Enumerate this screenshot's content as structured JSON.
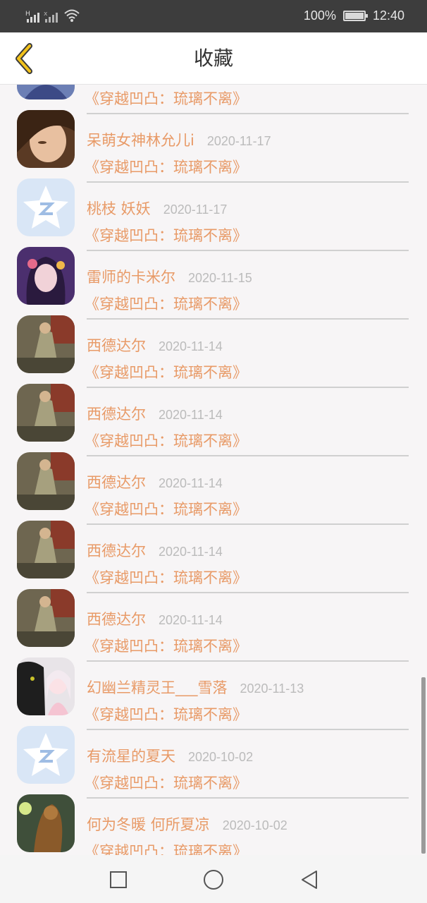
{
  "status_bar": {
    "signal1_tag": "H",
    "signal2_tag": "x",
    "battery": "100%",
    "time": "12:40",
    "icons": [
      "signal-icon",
      "signal-icon",
      "wifi-icon",
      "battery-icon"
    ]
  },
  "header": {
    "title": "收藏",
    "back_icon": "chevron-left-icon"
  },
  "items": [
    {
      "name": "",
      "date": "",
      "book": "《穿越凹凸：琉璃不离》",
      "avatar": "anime-portrait"
    },
    {
      "name": "呆萌女神林允儿i",
      "date": "2020-11-17",
      "book": "《穿越凹凸：琉璃不离》",
      "avatar": "photo-portrait"
    },
    {
      "name": "桃枝 妖妖",
      "date": "2020-11-17",
      "book": "《穿越凹凸：琉璃不离》",
      "avatar": "default-star-avatar"
    },
    {
      "name": "雷师的卡米尔",
      "date": "2020-11-15",
      "book": "《穿越凹凸：琉璃不离》",
      "avatar": "anime-portrait"
    },
    {
      "name": "西德达尔",
      "date": "2020-11-14",
      "book": "《穿越凹凸：琉璃不离》",
      "avatar": "warrior-art"
    },
    {
      "name": "西德达尔",
      "date": "2020-11-14",
      "book": "《穿越凹凸：琉璃不离》",
      "avatar": "warrior-art"
    },
    {
      "name": "西德达尔",
      "date": "2020-11-14",
      "book": "《穿越凹凸：琉璃不离》",
      "avatar": "warrior-art"
    },
    {
      "name": "西德达尔",
      "date": "2020-11-14",
      "book": "《穿越凹凸：琉璃不离》",
      "avatar": "warrior-art"
    },
    {
      "name": "西德达尔",
      "date": "2020-11-14",
      "book": "《穿越凹凸：琉璃不离》",
      "avatar": "warrior-art"
    },
    {
      "name": "幻幽兰精灵王___雪落",
      "date": "2020-11-13",
      "book": "《穿越凹凸：琉璃不离》",
      "avatar": "panther-girl-art"
    },
    {
      "name": "有流星的夏天",
      "date": "2020-10-02",
      "book": "《穿越凹凸：琉璃不离》",
      "avatar": "default-star-avatar"
    },
    {
      "name": "何为冬暖 何所夏凉",
      "date": "2020-10-02",
      "book": "《穿越凹凸：琉璃不离》",
      "avatar": "creature-art"
    }
  ],
  "nav": {
    "recent_icon": "square-icon",
    "home_icon": "circle-icon",
    "back_icon": "triangle-back-icon"
  },
  "colors": {
    "accent": "#e89a67",
    "date": "#bbbbbb",
    "status_bar": "#3d3d3d",
    "back_arrow": "#f2c21b"
  }
}
